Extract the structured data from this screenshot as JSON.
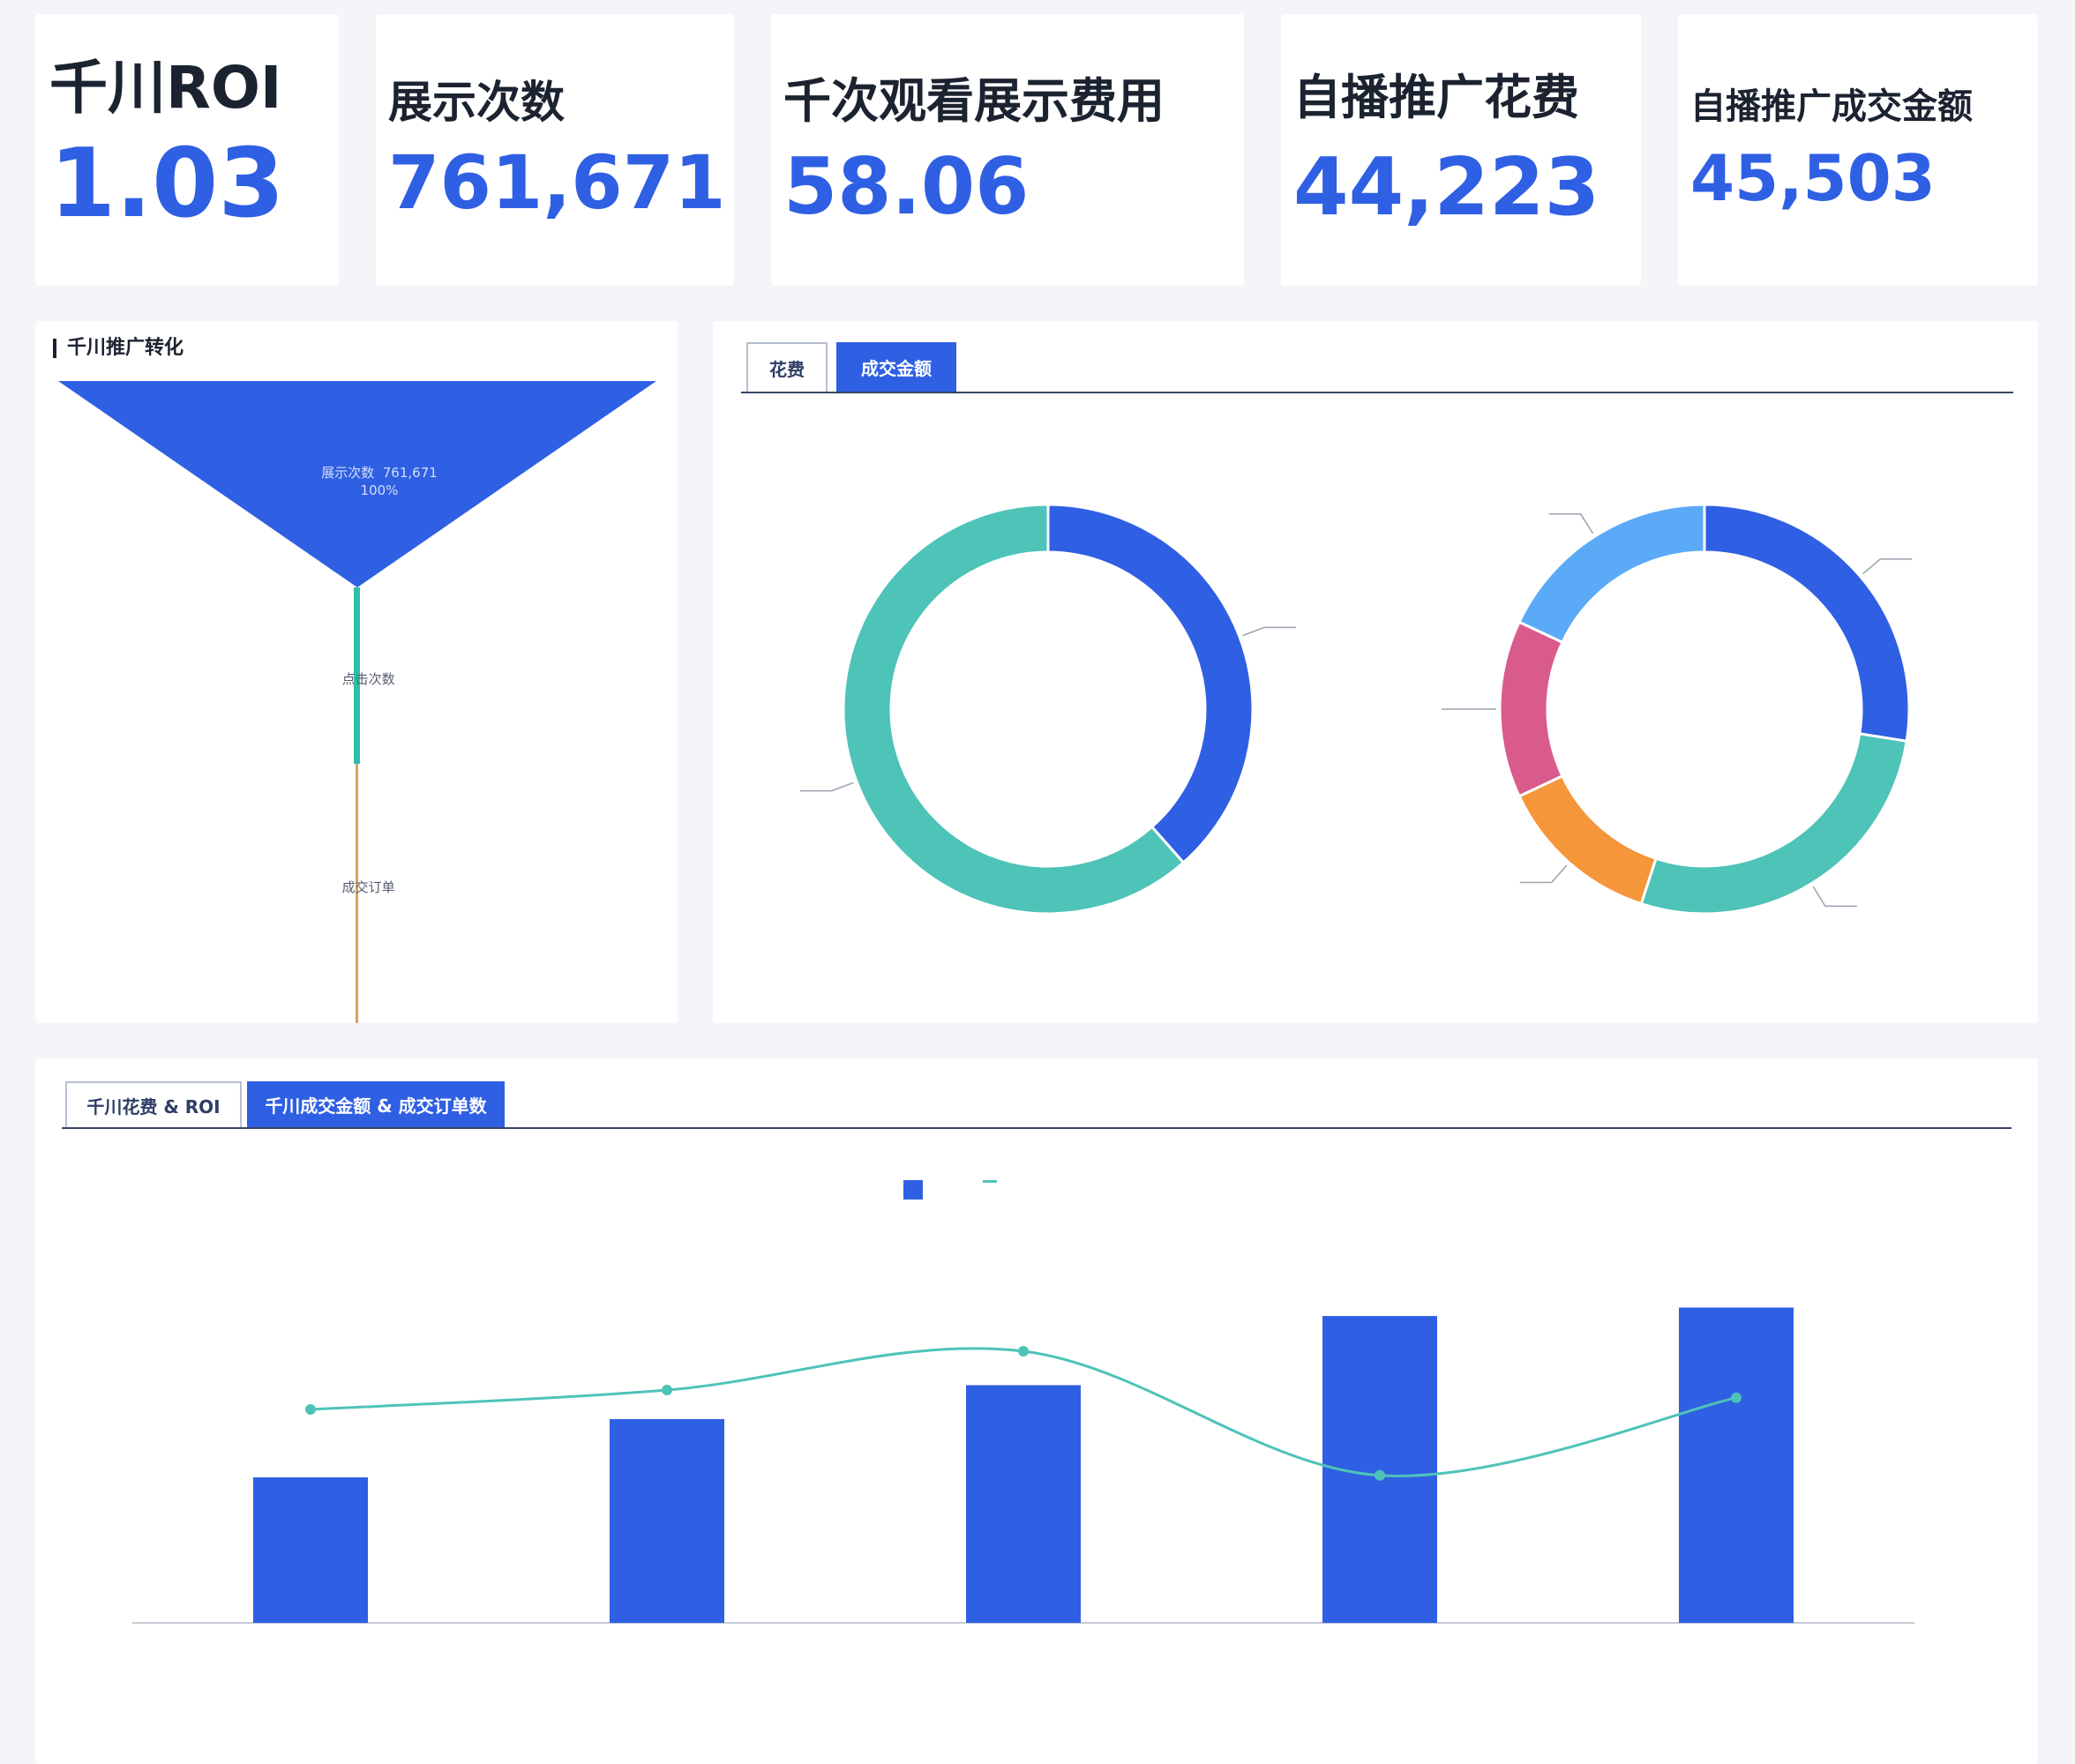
{
  "kpis": [
    {
      "label": "千川ROI",
      "value": "1.03"
    },
    {
      "label": "展示次数",
      "value": "761,671"
    },
    {
      "label": "千次观看展示费用",
      "value": "58.06"
    },
    {
      "label": "自播推广花费",
      "value": "44,223"
    },
    {
      "label": "自播推广成交金额",
      "value": "45,503"
    }
  ],
  "funnel": {
    "title": "千川推广转化",
    "stages": [
      {
        "name": "展示次数",
        "value": "761,671",
        "rate": "100%"
      },
      {
        "name": "点击次数",
        "value": "",
        "rate": ""
      },
      {
        "name": "成交订单",
        "value": "",
        "rate": ""
      }
    ]
  },
  "donut_panel": {
    "tabs": [
      {
        "label": "花费"
      },
      {
        "label": "成交金额"
      }
    ],
    "active_tab": 1
  },
  "trend_panel": {
    "tabs": [
      {
        "label": "千川花费 & ROI"
      },
      {
        "label": "千川成交金额 & 成交订单数"
      }
    ],
    "active_tab": 1
  },
  "colors": {
    "primary": "#2f5fe3",
    "teal": "#4ec3b8",
    "lightblue": "#5aaaf7",
    "pink": "#d95b8c",
    "orange": "#f5963a",
    "funnel_mid": "#2fbfa8",
    "funnel_bottom": "#d8a45a"
  },
  "chart_data": [
    {
      "type": "pie",
      "variant": "donut",
      "labels": [
        "",
        ""
      ],
      "values": [
        38.5,
        61.5
      ],
      "colors": [
        "#2f5fe3",
        "#4ec3b8"
      ]
    },
    {
      "type": "pie",
      "variant": "donut",
      "labels": [
        "",
        "",
        "",
        "",
        ""
      ],
      "values": [
        27.5,
        27.5,
        13.0,
        14.0,
        18.0
      ],
      "colors": [
        "#2f5fe3",
        "#4ec3b8",
        "#f5963a",
        "#d95b8c",
        "#5aaaf7"
      ]
    },
    {
      "type": "bar",
      "categories": [
        "",
        "",
        "",
        "",
        ""
      ],
      "series": [
        {
          "kind": "bar",
          "axis": "left",
          "values": [
            1200,
            1680,
            1960,
            2530,
            2600
          ]
        },
        {
          "kind": "line",
          "axis": "right",
          "values": [
            1.15,
            1.2,
            1.3,
            0.98,
            1.18
          ]
        }
      ],
      "left_ylim": [
        0,
        3200
      ],
      "right_ylim": [
        0.6,
        1.6
      ],
      "grid": false,
      "legend_placement": "top-center"
    }
  ]
}
